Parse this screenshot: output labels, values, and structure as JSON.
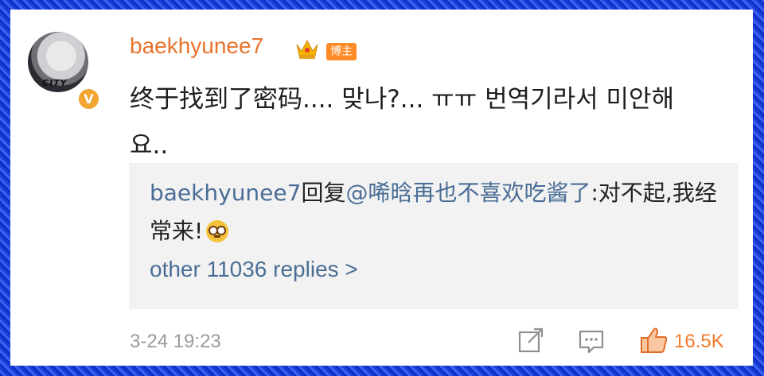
{
  "post": {
    "username": "baekhyunee7",
    "badge": "博主",
    "avatar_text": "CITY",
    "verified_glyph": "V",
    "comment_text": "终于找到了密码.... 맞나?... ㅠㅠ 번역기라서 미안해요..",
    "timestamp": "3-24 19:23",
    "like_count": "16.5K"
  },
  "reply": {
    "author": "baekhyunee7",
    "action": "回复",
    "mention": "@唏晗再也不喜欢吃酱了",
    "text": ":对不起,我经常来!",
    "more_replies": "other 11036 replies >"
  },
  "icons": {
    "crown": "crown-icon",
    "share": "share-icon",
    "comment": "comment-icon",
    "like": "like-icon",
    "emoji": "flushed-face-emoji"
  },
  "colors": {
    "username": "#e8732c",
    "link": "#4a6d96",
    "badge": "#ff8a28",
    "like": "#f07a2b",
    "border": "#1a3fd8"
  }
}
